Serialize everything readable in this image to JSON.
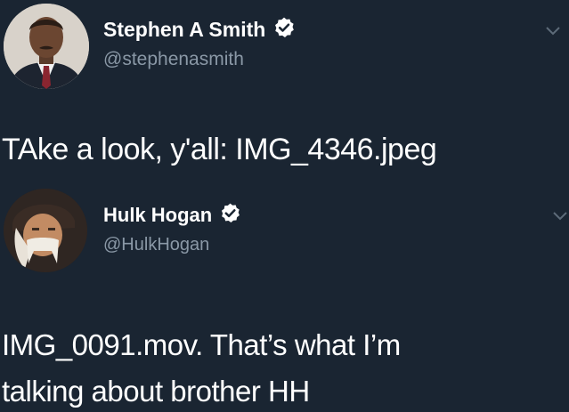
{
  "tweets": [
    {
      "author": {
        "display_name": "Stephen A Smith",
        "handle": "@stephenasmith",
        "verified": true,
        "avatar_icon": "profile-photo-man-suit"
      },
      "text": "TAke a look, y'all: IMG_4346.jpeg",
      "menu_icon": "chevron-down-icon"
    },
    {
      "author": {
        "display_name": "Hulk Hogan",
        "handle": "@HulkHogan",
        "verified": true,
        "avatar_icon": "profile-photo-man-bandana"
      },
      "text_lines": [
        "IMG_0091.mov.  That’s what I’m",
        "talking about brother HH"
      ],
      "menu_icon": "chevron-down-icon"
    }
  ],
  "colors": {
    "background": "#1a2532",
    "text": "#ffffff",
    "handle": "#8a98a6",
    "verified_badge": "#ffffff"
  }
}
